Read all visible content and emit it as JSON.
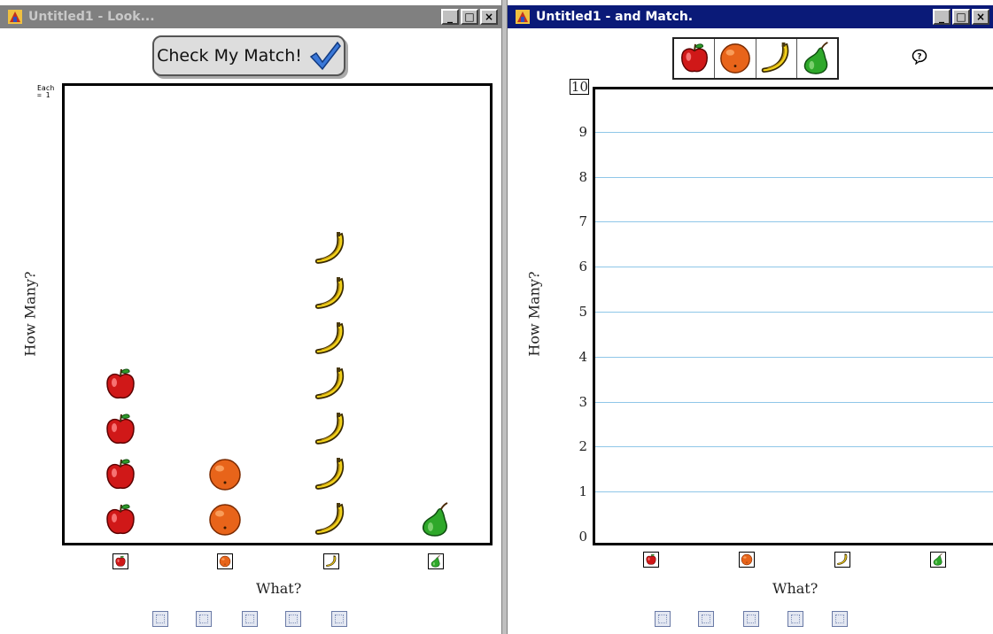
{
  "left_window": {
    "title": "Untitled1 - Look...",
    "title_active": false,
    "controls": {
      "minimize": "_",
      "maximize": "□",
      "close": "×"
    },
    "check_button_label": "Check My Match!",
    "key_label": "Each\n= 1",
    "y_axis_label": "How Many?",
    "x_axis_label": "What?"
  },
  "right_window": {
    "title": "Untitled1 - and Match.",
    "title_active": true,
    "controls": {
      "minimize": "_",
      "maximize": "□",
      "close": "×"
    },
    "palette_icons": [
      "apple-icon",
      "orange-icon",
      "banana-icon",
      "pear-icon"
    ],
    "help_icon": "speech-bubble-question-icon",
    "y_axis_label": "How Many?",
    "x_axis_label": "What?",
    "y_ticks": [
      "0",
      "1",
      "2",
      "3",
      "4",
      "5",
      "6",
      "7",
      "8",
      "9",
      "10"
    ]
  },
  "chart_data": [
    {
      "type": "bar",
      "style": "pictograph",
      "categories": [
        "apple",
        "orange",
        "banana",
        "pear"
      ],
      "values": [
        4,
        2,
        7,
        1
      ],
      "xlabel": "What?",
      "ylabel": "How Many?",
      "key": "Each = 1"
    },
    {
      "type": "bar",
      "categories": [
        "apple",
        "orange",
        "banana",
        "pear"
      ],
      "values": [
        0,
        0,
        0,
        0
      ],
      "xlabel": "What?",
      "ylabel": "How Many?",
      "ylim": [
        0,
        10
      ],
      "grid": true
    }
  ],
  "toolbar_icons": [
    "table-view-icon",
    "scatter-view-icon",
    "bar-view-icon",
    "line-view-icon",
    "pie-view-icon"
  ],
  "colors": {
    "active_titlebar": "#0a1a78",
    "inactive_titlebar": "#808080",
    "grid_line": "#8fc7e8",
    "apple": "#d01818",
    "orange": "#e8641a",
    "banana": "#f2d21c",
    "pear": "#2ea82a"
  }
}
